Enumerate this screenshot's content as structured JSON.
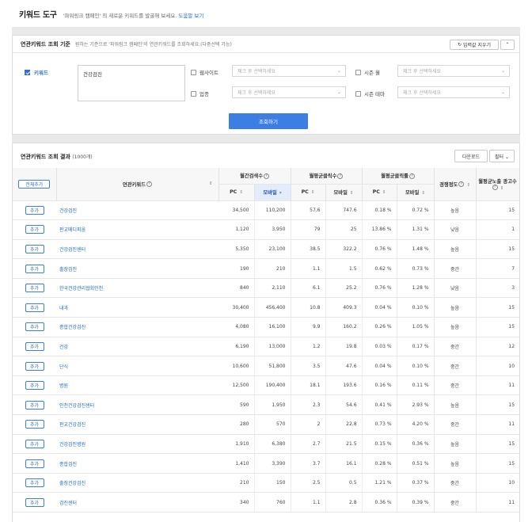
{
  "header": {
    "title": "키워드 도구",
    "desc_prefix": "'파워링크 캠페인' 의 새로운 키워드를 발굴해 보세요.",
    "help_link": "도움말 보기"
  },
  "criteria": {
    "title": "연관키워드 조회 기준",
    "desc": "원하는 기준으로 '파워링크 캠페인'의 연관키워드를 조회하세요.(다중선택 가능)",
    "reset_label": "입력값 지우기",
    "collapse_label": "⌃",
    "keyword_label": "키워드",
    "keyword_checked": true,
    "keyword_value": "건강검진",
    "website_label": "웹사이트",
    "website_placeholder": "체크 후 선택하세요",
    "season_month_label": "시즌 월",
    "season_month_placeholder": "체크 후 선택하세요",
    "industry_label": "업종",
    "industry_placeholder": "체크 후 선택하세요",
    "season_theme_label": "시즌 테마",
    "season_theme_placeholder": "체크 후 선택하세요",
    "search_label": "조회하기"
  },
  "results": {
    "title": "연관키워드 조회 결과",
    "count": "(1000개)",
    "download_label": "다운로드",
    "filter_label": "필터 ⌄",
    "headers": {
      "add_all": "전체추가",
      "keyword": "연관키워드",
      "monthly_search": "월간검색수",
      "avg_clicks": "월평균클릭수",
      "avg_ctr": "월평균클릭률",
      "competition": "경쟁정도",
      "avg_ad_count": "월평균노출 광고수",
      "pc": "PC",
      "mobile": "모바일"
    },
    "add_label": "추가",
    "rows": [
      {
        "kw": "건강검진",
        "s_pc": "34,500",
        "s_mo": "110,200",
        "c_pc": "57.6",
        "c_mo": "747.6",
        "r_pc": "0.18 %",
        "r_mo": "0.72 %",
        "comp": "높음",
        "ads": "15"
      },
      {
        "kw": "판교메디피움",
        "s_pc": "1,120",
        "s_mo": "3,950",
        "c_pc": "79",
        "c_mo": "25",
        "r_pc": "13.86 %",
        "r_mo": "1.31 %",
        "comp": "낮음",
        "ads": "1"
      },
      {
        "kw": "건강검진센터",
        "s_pc": "5,350",
        "s_mo": "23,100",
        "c_pc": "38.5",
        "c_mo": "322.2",
        "r_pc": "0.76 %",
        "r_mo": "1.48 %",
        "comp": "높음",
        "ads": "15"
      },
      {
        "kw": "출장검진",
        "s_pc": "190",
        "s_mo": "210",
        "c_pc": "1.1",
        "c_mo": "1.5",
        "r_pc": "0.62 %",
        "r_mo": "0.73 %",
        "comp": "중간",
        "ads": "7"
      },
      {
        "kw": "한국건강관리협회인천",
        "s_pc": "840",
        "s_mo": "2,110",
        "c_pc": "6.1",
        "c_mo": "25.2",
        "r_pc": "0.76 %",
        "r_mo": "1.28 %",
        "comp": "낮음",
        "ads": "3"
      },
      {
        "kw": "내과",
        "s_pc": "30,400",
        "s_mo": "456,400",
        "c_pc": "10.8",
        "c_mo": "409.3",
        "r_pc": "0.04 %",
        "r_mo": "0.10 %",
        "comp": "높음",
        "ads": "15"
      },
      {
        "kw": "종합건강검진",
        "s_pc": "4,080",
        "s_mo": "16,100",
        "c_pc": "9.9",
        "c_mo": "160.2",
        "r_pc": "0.26 %",
        "r_mo": "1.05 %",
        "comp": "높음",
        "ads": "15"
      },
      {
        "kw": "건강",
        "s_pc": "6,190",
        "s_mo": "13,000",
        "c_pc": "1.2",
        "c_mo": "19.8",
        "r_pc": "0.03 %",
        "r_mo": "0.17 %",
        "comp": "중간",
        "ads": "12"
      },
      {
        "kw": "단식",
        "s_pc": "10,600",
        "s_mo": "51,800",
        "c_pc": "3.5",
        "c_mo": "47.6",
        "r_pc": "0.04 %",
        "r_mo": "0.10 %",
        "comp": "중간",
        "ads": "10"
      },
      {
        "kw": "병원",
        "s_pc": "12,500",
        "s_mo": "190,400",
        "c_pc": "18.1",
        "c_mo": "193.6",
        "r_pc": "0.16 %",
        "r_mo": "0.11 %",
        "comp": "중간",
        "ads": "11"
      },
      {
        "kw": "인천건강검진센터",
        "s_pc": "590",
        "s_mo": "1,950",
        "c_pc": "2.3",
        "c_mo": "54.6",
        "r_pc": "0.41 %",
        "r_mo": "2.93 %",
        "comp": "높음",
        "ads": "15"
      },
      {
        "kw": "판교건강검진",
        "s_pc": "280",
        "s_mo": "570",
        "c_pc": "2",
        "c_mo": "22.8",
        "r_pc": "0.73 %",
        "r_mo": "4.20 %",
        "comp": "중간",
        "ads": "11"
      },
      {
        "kw": "건강검진병원",
        "s_pc": "1,910",
        "s_mo": "6,380",
        "c_pc": "2.7",
        "c_mo": "21.5",
        "r_pc": "0.15 %",
        "r_mo": "0.36 %",
        "comp": "높음",
        "ads": "15"
      },
      {
        "kw": "종합검진",
        "s_pc": "1,410",
        "s_mo": "3,390",
        "c_pc": "3.7",
        "c_mo": "16.1",
        "r_pc": "0.28 %",
        "r_mo": "0.51 %",
        "comp": "높음",
        "ads": "15"
      },
      {
        "kw": "출장건강검진",
        "s_pc": "210",
        "s_mo": "150",
        "c_pc": "2.5",
        "c_mo": "0.5",
        "r_pc": "1.21 %",
        "r_mo": "0.37 %",
        "comp": "중간",
        "ads": "10"
      },
      {
        "kw": "검진센터",
        "s_pc": "340",
        "s_mo": "760",
        "c_pc": "1.1",
        "c_mo": "2.8",
        "r_pc": "0.36 %",
        "r_mo": "0.39 %",
        "comp": "중간",
        "ads": "11"
      }
    ]
  }
}
